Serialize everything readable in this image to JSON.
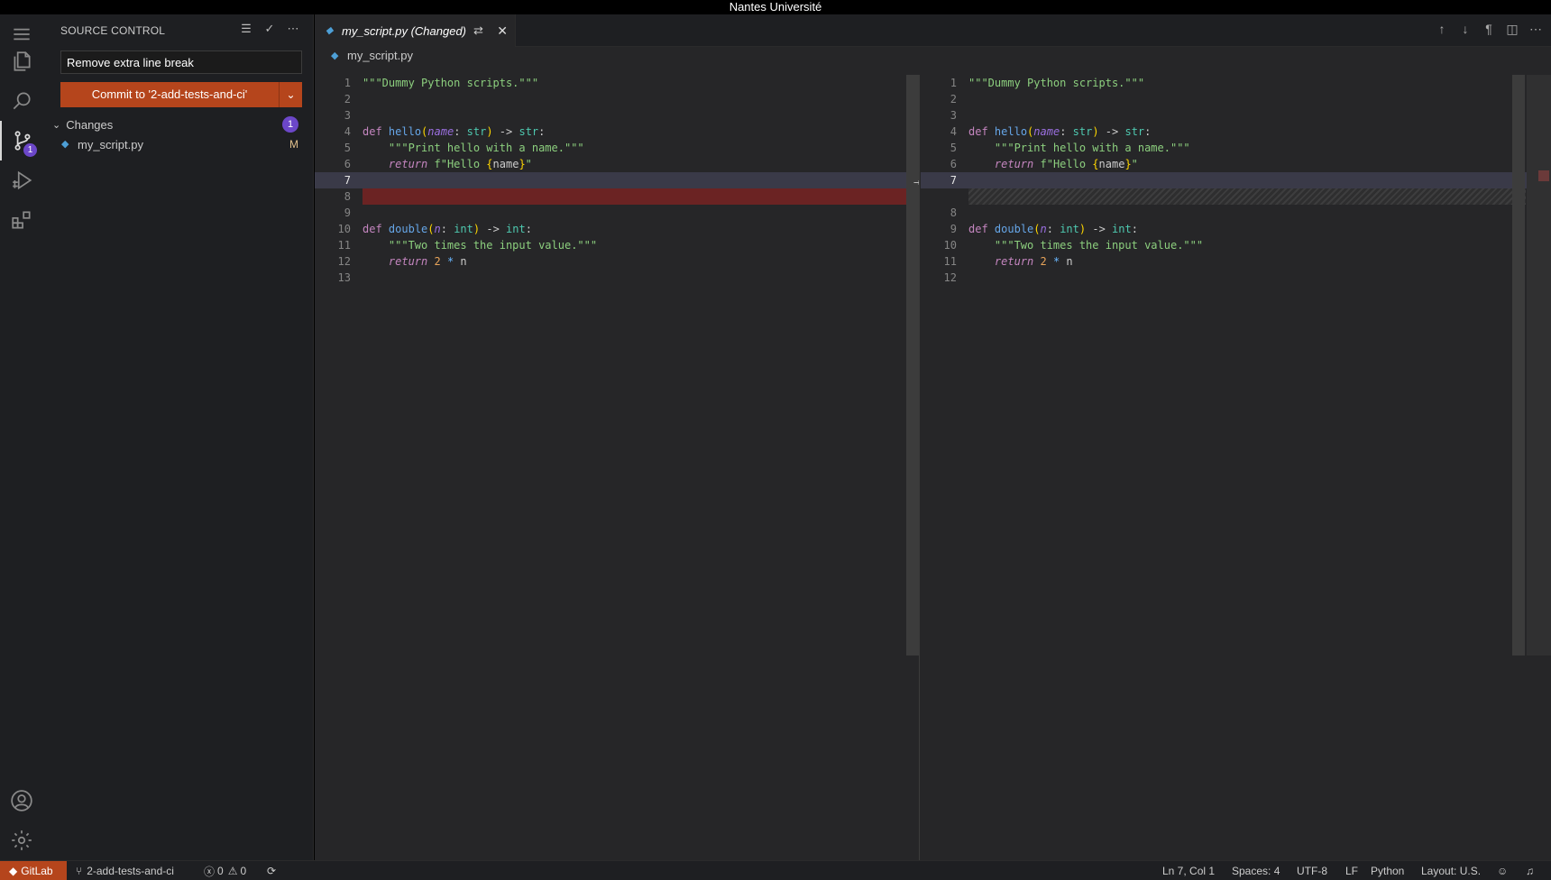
{
  "window": {
    "title": "Nantes Université"
  },
  "sidebar": {
    "title": "SOURCE CONTROL",
    "commit_message": "Remove extra line break",
    "commit_button": "Commit to '2-add-tests-and-ci'",
    "changes_label": "Changes",
    "changes_count": "1",
    "file_name": "my_script.py",
    "file_status": "M",
    "scm_badge": "1"
  },
  "editor": {
    "tab_title": "my_script.py (Changed)",
    "breadcrumb": "my_script.py",
    "left_line_numbers": [
      "1",
      "2",
      "3",
      "4",
      "5",
      "6",
      "7",
      "8",
      "9",
      "10",
      "11",
      "12",
      "13"
    ],
    "right_line_numbers": [
      "1",
      "2",
      "3",
      "4",
      "5",
      "6",
      "7",
      "",
      "8",
      "9",
      "10",
      "11",
      "12"
    ]
  },
  "colors": {
    "accent": "#b5451c",
    "badge": "#6c47c9",
    "deleted": "#6b2323"
  },
  "status": {
    "gitlab": "GitLab",
    "branch": "2-add-tests-and-ci",
    "errors": "0",
    "warnings": "0",
    "position": "Ln 7, Col 1",
    "spaces": "Spaces: 4",
    "encoding": "UTF-8",
    "eol": "LF",
    "language": "Python",
    "layout": "Layout: U.S."
  }
}
